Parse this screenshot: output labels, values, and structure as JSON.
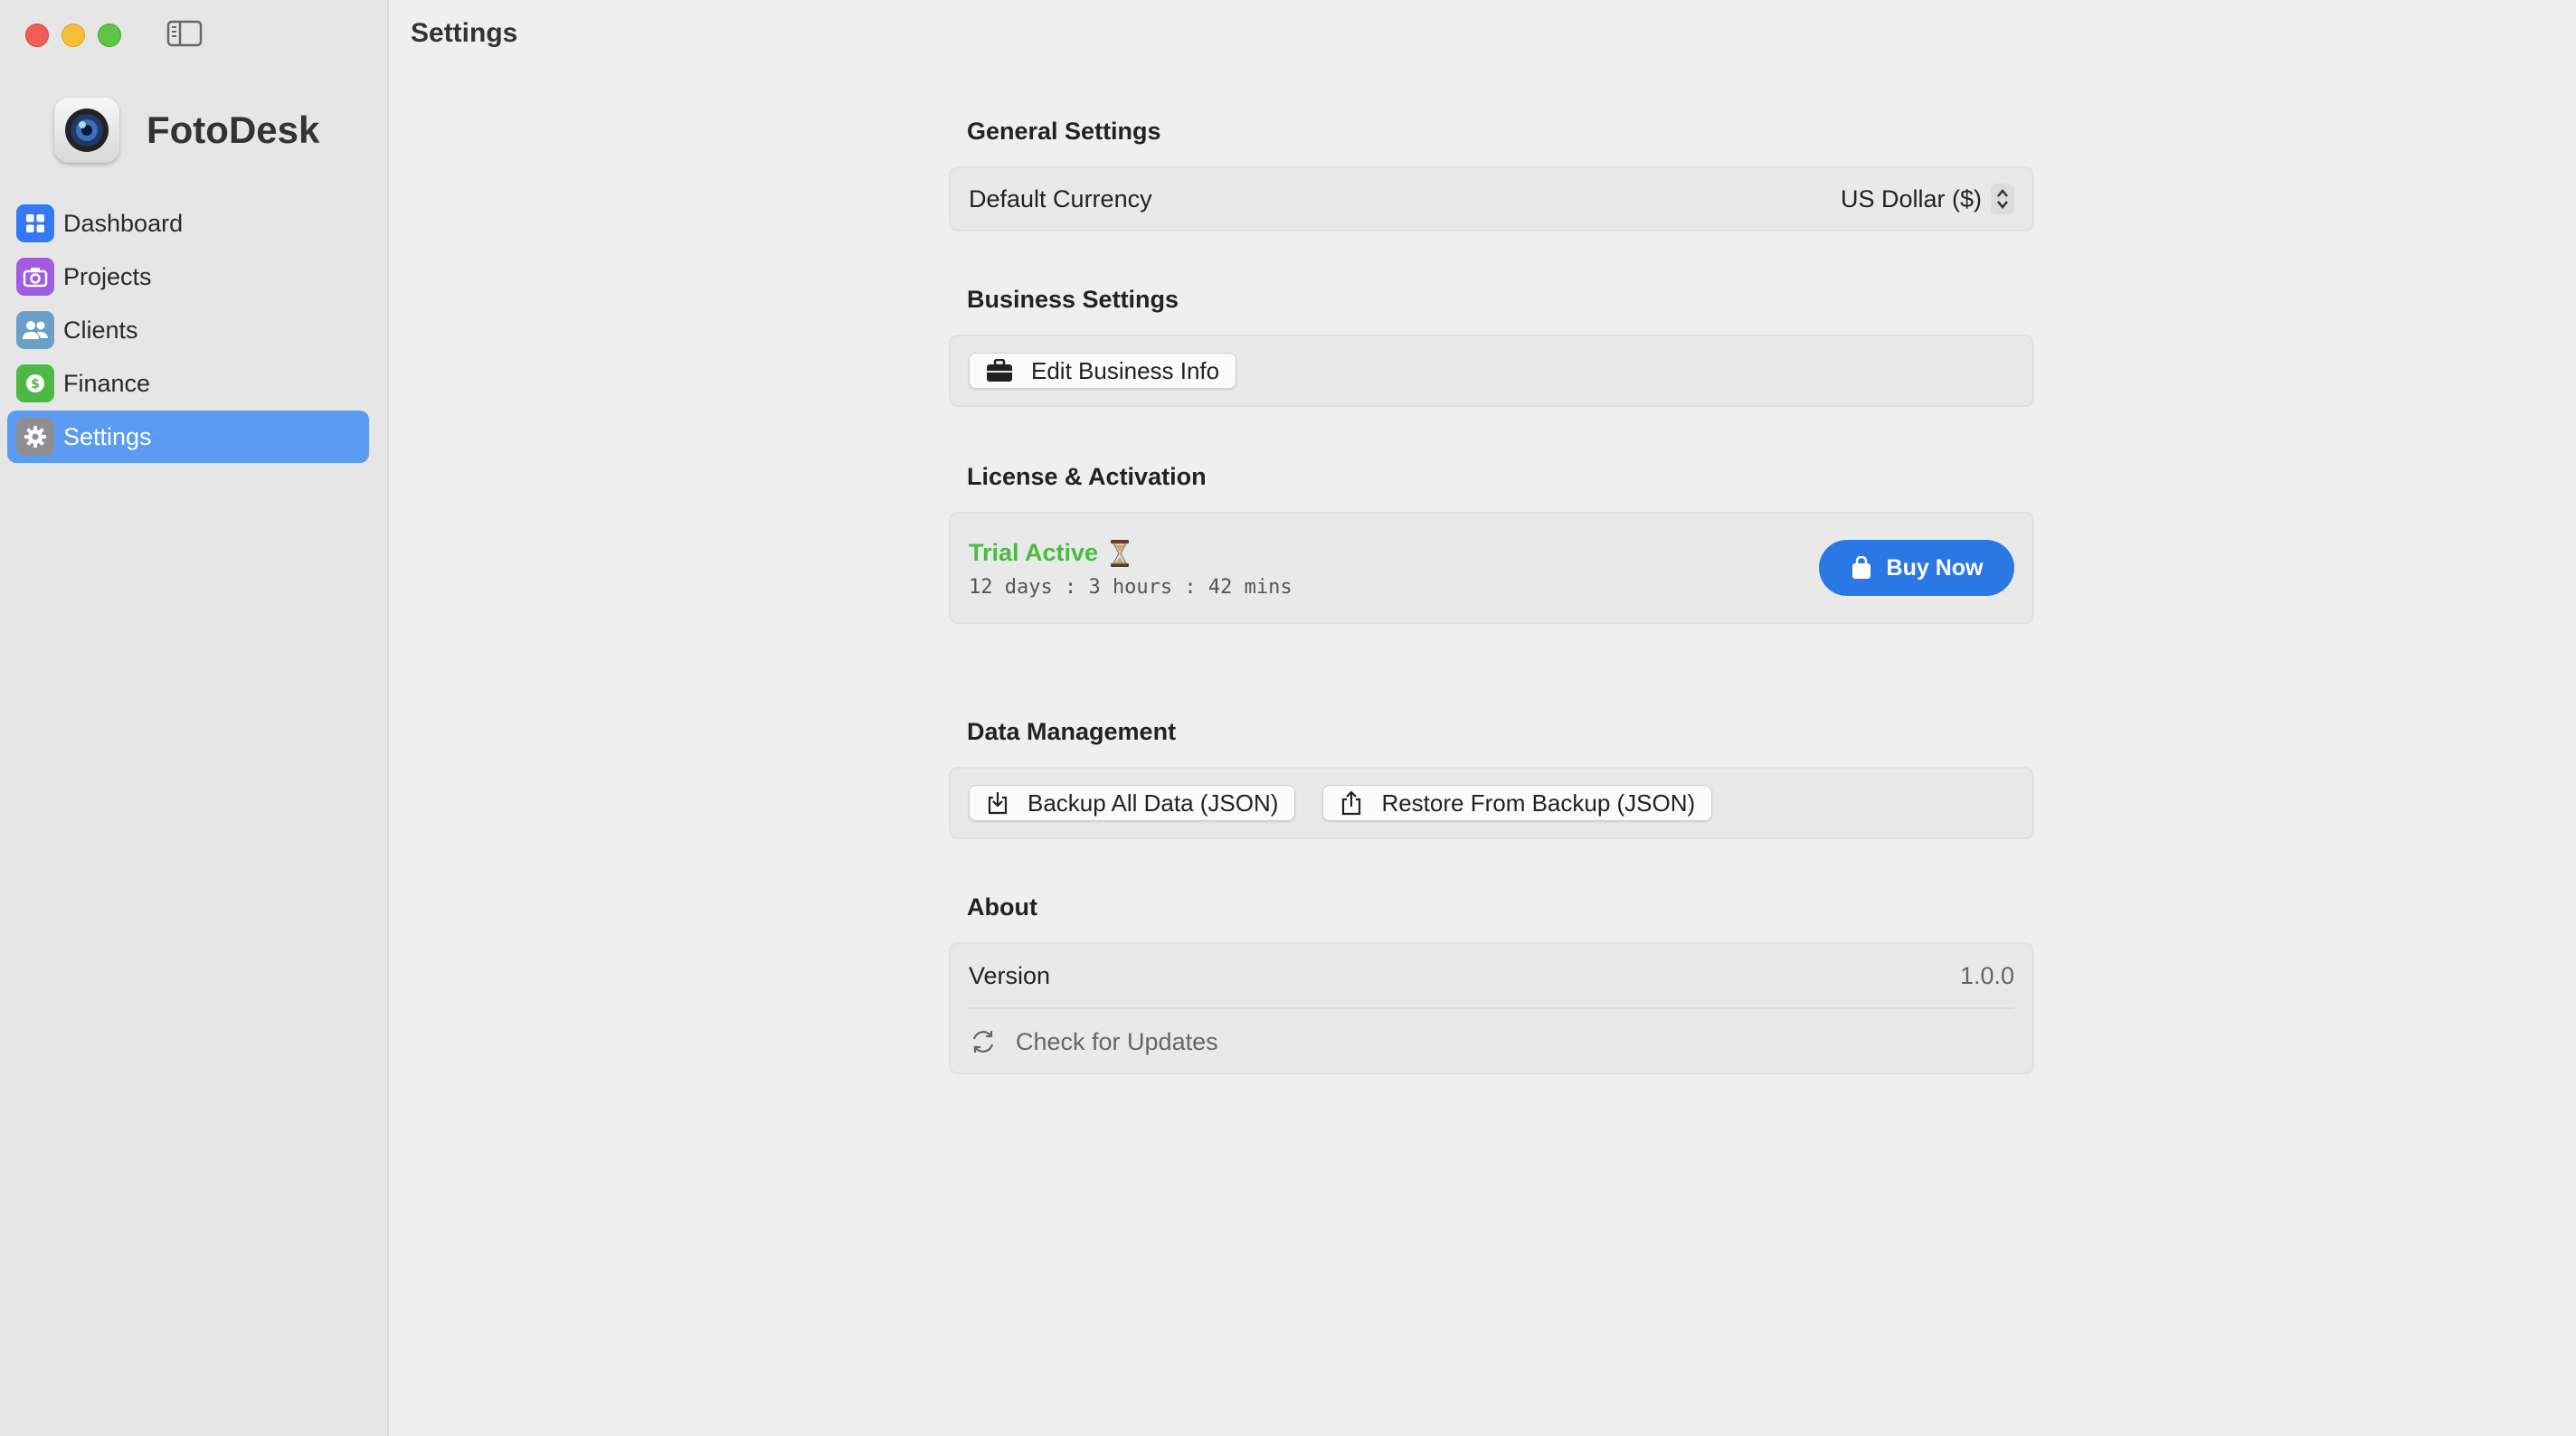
{
  "window": {
    "title": "Settings"
  },
  "app": {
    "name": "FotoDesk"
  },
  "sidebar": {
    "items": [
      {
        "label": "Dashboard",
        "icon": "grid-icon",
        "color": "#3478f6"
      },
      {
        "label": "Projects",
        "icon": "camera-icon",
        "color": "#a25ce0"
      },
      {
        "label": "Clients",
        "icon": "people-icon",
        "color": "#6aa0c8"
      },
      {
        "label": "Finance",
        "icon": "money-icon",
        "color": "#4cb944"
      },
      {
        "label": "Settings",
        "icon": "gear-icon",
        "color": "#8e8e93",
        "active": true
      }
    ]
  },
  "general": {
    "title": "General Settings",
    "currency_label": "Default Currency",
    "currency_value": "US Dollar ($)"
  },
  "business": {
    "title": "Business Settings",
    "edit_button": "Edit Business Info"
  },
  "license": {
    "title": "License & Activation",
    "status": "Trial Active",
    "status_color": "#4cb944",
    "countdown": "12 days : 3 hours : 42 mins",
    "buy_button": "Buy Now",
    "buy_color": "#2b78e4"
  },
  "data_management": {
    "title": "Data Management",
    "backup_button": "Backup All Data (JSON)",
    "restore_button": "Restore From Backup (JSON)"
  },
  "about": {
    "title": "About",
    "version_label": "Version",
    "version_value": "1.0.0",
    "update_label": "Check for Updates"
  },
  "colors": {
    "accent": "#5b9bf2",
    "sidebar_bg": "#e6e6e6",
    "content_bg": "#efefef"
  }
}
